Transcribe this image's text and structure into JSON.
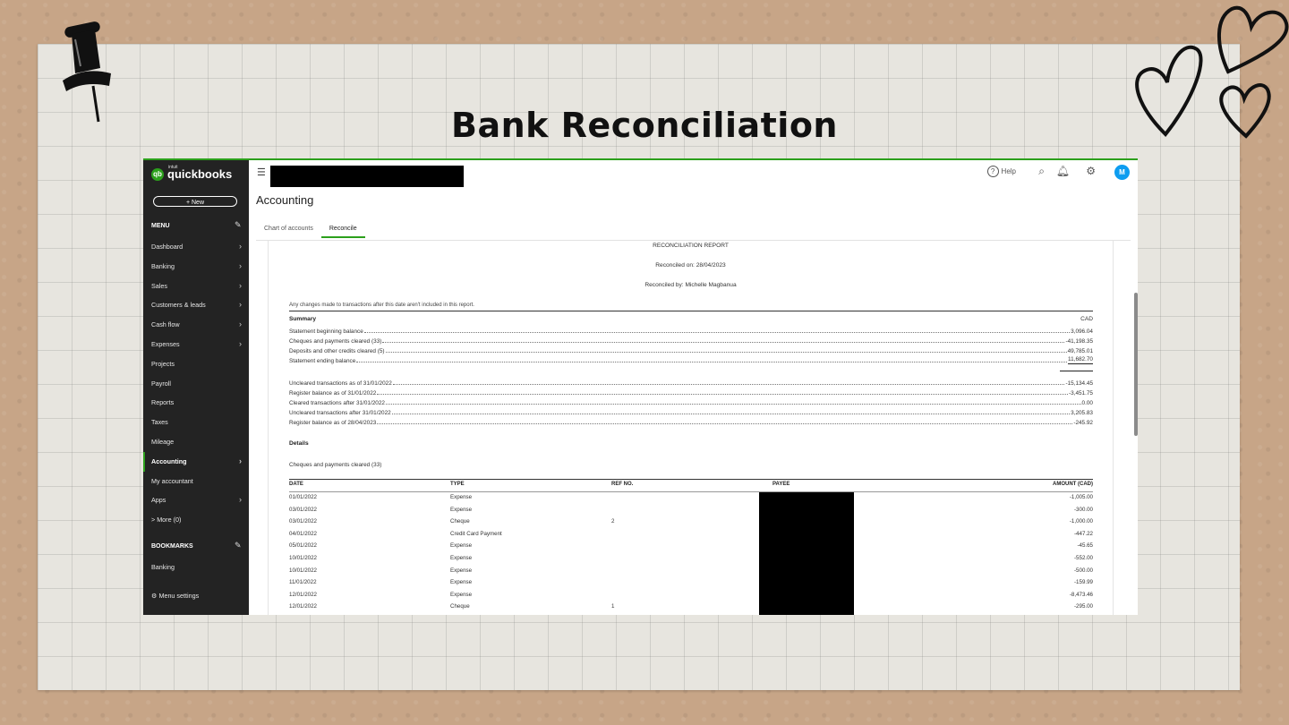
{
  "slide": {
    "title": "Bank Reconciliation"
  },
  "app": {
    "brand": {
      "intuit": "intuit",
      "name": "quickbooks",
      "logo": "qb"
    },
    "new_button": "+ New",
    "menu_heading": "MENU",
    "nav": [
      {
        "label": "Dashboard",
        "chevron": true,
        "active": false
      },
      {
        "label": "Banking",
        "chevron": true,
        "active": false
      },
      {
        "label": "Sales",
        "chevron": true,
        "active": false
      },
      {
        "label": "Customers & leads",
        "chevron": true,
        "active": false
      },
      {
        "label": "Cash flow",
        "chevron": true,
        "active": false
      },
      {
        "label": "Expenses",
        "chevron": true,
        "active": false
      },
      {
        "label": "Projects",
        "chevron": false,
        "active": false
      },
      {
        "label": "Payroll",
        "chevron": false,
        "active": false
      },
      {
        "label": "Reports",
        "chevron": false,
        "active": false
      },
      {
        "label": "Taxes",
        "chevron": false,
        "active": false
      },
      {
        "label": "Mileage",
        "chevron": false,
        "active": false
      },
      {
        "label": "Accounting",
        "chevron": true,
        "active": true
      },
      {
        "label": "My accountant",
        "chevron": false,
        "active": false
      },
      {
        "label": "Apps",
        "chevron": true,
        "active": false
      },
      {
        "label": "> More (0)",
        "chevron": false,
        "active": false
      }
    ],
    "bookmarks_heading": "BOOKMARKS",
    "bookmarks": [
      "Banking"
    ],
    "menu_settings": "Menu settings",
    "topbar": {
      "help": "Help",
      "avatar": "M"
    },
    "page_title": "Accounting",
    "tabs": [
      {
        "label": "Chart of accounts",
        "active": false
      },
      {
        "label": "Reconcile",
        "active": true
      }
    ],
    "icons": [
      "hamburger-icon",
      "help-icon",
      "search-icon",
      "bell-icon",
      "gear-icon",
      "pencil-icon",
      "chevron-right-icon"
    ]
  },
  "report": {
    "title": "RECONCILIATION REPORT",
    "reconciled_on": "Reconciled on: 28/04/2023",
    "reconciled_by": "Reconciled by: Michelle Magbanua",
    "note": "Any changes made to transactions after this date aren't included in this report.",
    "summary_heading": "Summary",
    "currency": "CAD",
    "summary": [
      {
        "label": "Statement beginning balance",
        "amount": "3,096.04"
      },
      {
        "label": "Cheques and payments cleared (33)",
        "amount": "-41,198.35"
      },
      {
        "label": "Deposits and other credits cleared (5)",
        "amount": "49,785.01"
      },
      {
        "label": "Statement ending balance",
        "amount": "11,682.70"
      }
    ],
    "summary2": [
      {
        "label": "Uncleared transactions as of 31/01/2022",
        "amount": "-15,134.45"
      },
      {
        "label": "Register balance as of 31/01/2022",
        "amount": "-3,451.75"
      },
      {
        "label": "Cleared transactions after 31/01/2022",
        "amount": "0.00"
      },
      {
        "label": "Uncleared transactions after 31/01/2022",
        "amount": "3,205.83"
      },
      {
        "label": "Register balance as of 28/04/2023",
        "amount": "-245.92"
      }
    ],
    "details_heading": "Details",
    "details_sub": "Cheques and payments cleared (33)",
    "columns": {
      "date": "DATE",
      "type": "TYPE",
      "ref": "REF NO.",
      "payee": "PAYEE",
      "amount": "AMOUNT (CAD)"
    },
    "rows": [
      {
        "date": "01/01/2022",
        "type": "Expense",
        "ref": "",
        "amount": "-1,005.00"
      },
      {
        "date": "03/01/2022",
        "type": "Expense",
        "ref": "",
        "amount": "-300.00"
      },
      {
        "date": "03/01/2022",
        "type": "Cheque",
        "ref": "2",
        "amount": "-1,000.00"
      },
      {
        "date": "04/01/2022",
        "type": "Credit Card Payment",
        "ref": "",
        "amount": "-447.22"
      },
      {
        "date": "05/01/2022",
        "type": "Expense",
        "ref": "",
        "amount": "-45.65"
      },
      {
        "date": "10/01/2022",
        "type": "Expense",
        "ref": "",
        "amount": "-552.00"
      },
      {
        "date": "10/01/2022",
        "type": "Expense",
        "ref": "",
        "amount": "-500.00"
      },
      {
        "date": "11/01/2022",
        "type": "Expense",
        "ref": "",
        "amount": "-159.99"
      },
      {
        "date": "12/01/2022",
        "type": "Expense",
        "ref": "",
        "amount": "-8,473.46"
      },
      {
        "date": "12/01/2022",
        "type": "Cheque",
        "ref": "1",
        "amount": "-295.00"
      }
    ]
  }
}
